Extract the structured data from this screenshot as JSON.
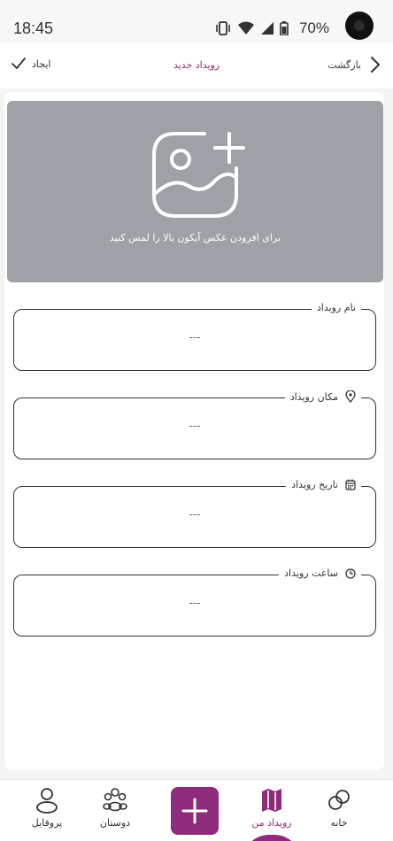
{
  "status_bar": {
    "time": "18:45",
    "battery": "70%"
  },
  "header": {
    "create_label": "ایجاد",
    "title": "رویداد جدید",
    "back_label": "بازگشت"
  },
  "image_picker": {
    "hint": "برای افزودن عکس آیکون بالا را لمس کنید"
  },
  "fields": [
    {
      "label": "نام رویداد",
      "value": "---"
    },
    {
      "label": "مکان رویداد",
      "value": "---",
      "icon": "location-icon"
    },
    {
      "label": "تاریخ رویداد",
      "value": "---",
      "icon": "calendar-icon"
    },
    {
      "label": "ساعت رویداد",
      "value": "---",
      "icon": "clock-icon"
    }
  ],
  "bottom_nav": {
    "profile": "پروفایل",
    "friends": "دوستان",
    "my_events": "رویداد من",
    "home": "خانه"
  },
  "colors": {
    "accent": "#8e2b7a",
    "image_bg": "#9ea1a6"
  }
}
